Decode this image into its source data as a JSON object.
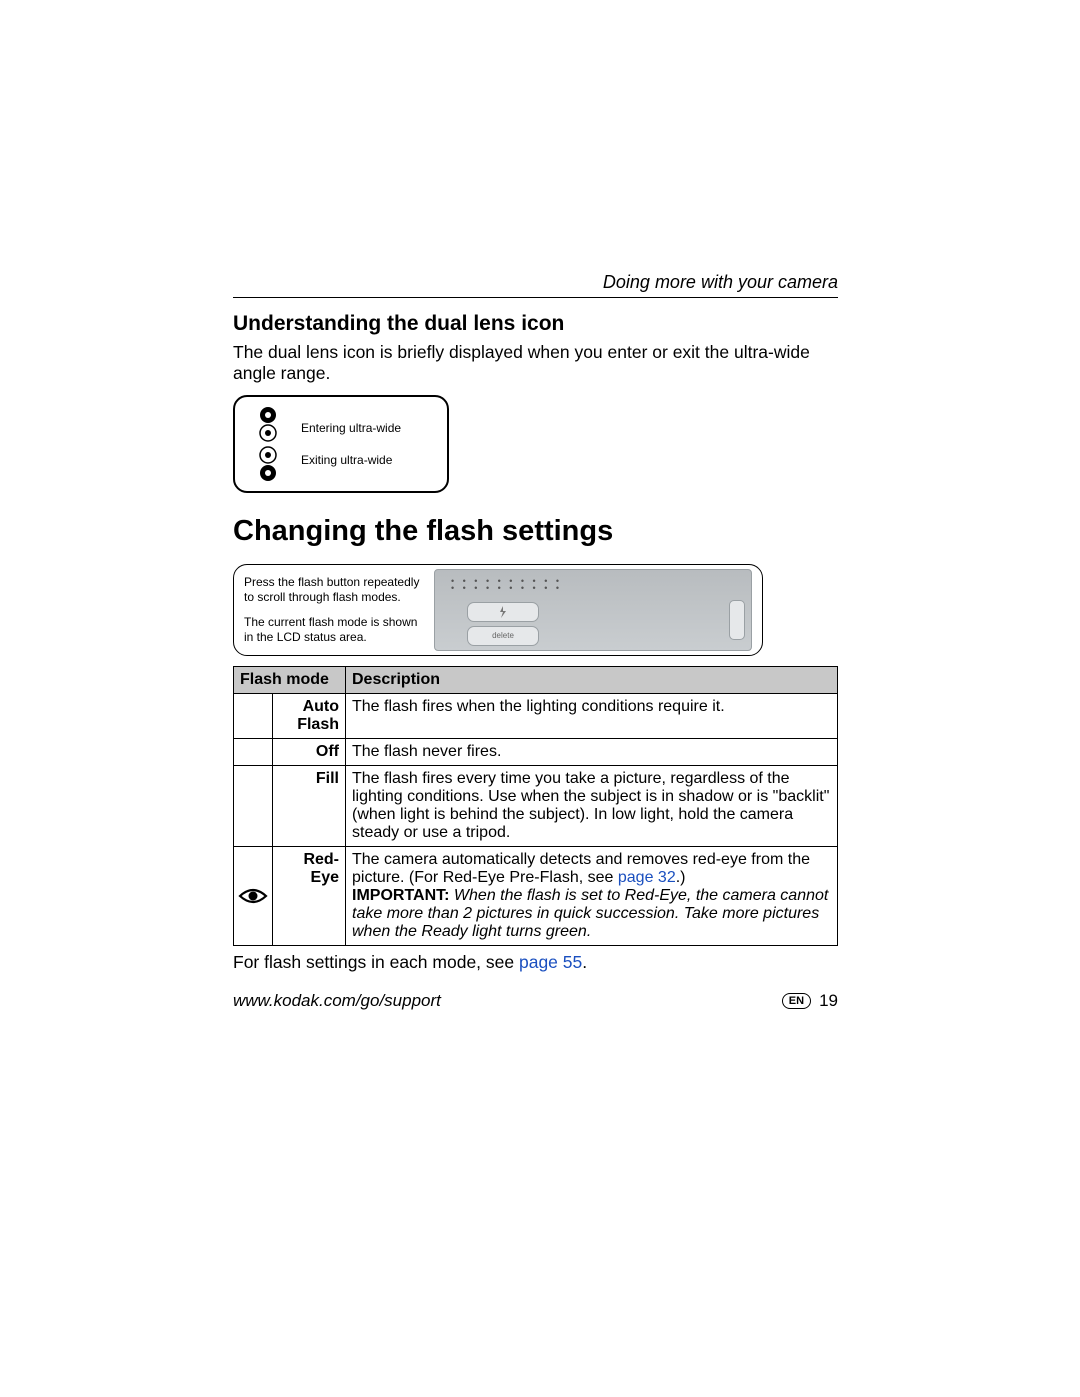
{
  "chapter": "Doing more with your camera",
  "section1": {
    "heading": "Understanding the dual lens icon",
    "body": "The dual lens icon is briefly displayed when you enter or exit the ultra-wide angle range.",
    "label_enter": "Entering ultra-wide",
    "label_exit": "Exiting ultra-wide"
  },
  "section2": {
    "heading": "Changing the flash settings",
    "callout_line1": "Press the flash button repeatedly to scroll through flash modes.",
    "callout_line2": "The current flash mode is shown in the LCD status area.",
    "camera_btn2_label": "delete"
  },
  "table": {
    "col1": "Flash mode",
    "col2": "Description",
    "rows": [
      {
        "mode": "Auto Flash",
        "desc": "The flash fires when the lighting conditions require it."
      },
      {
        "mode": "Off",
        "desc": "The flash never fires."
      },
      {
        "mode": "Fill",
        "desc": "The flash fires every time you take a picture, regardless of the lighting conditions. Use when the subject is in shadow or is \"backlit\" (when light is behind the subject). In low light, hold the camera steady or use a tripod."
      },
      {
        "mode": "Red-Eye",
        "desc_pre": "The camera automatically detects and removes red-eye from the picture. (For Red-Eye Pre-Flash, see ",
        "desc_link": "page 32",
        "desc_post": ".)",
        "important_label": "IMPORTANT:",
        "important_text": "When the flash is set to Red-Eye, the camera cannot take more than 2 pictures in quick succession. Take more pictures when the Ready light turns green."
      }
    ]
  },
  "after_table_pre": "For flash settings in each mode, see ",
  "after_table_link": "page 55",
  "after_table_post": ".",
  "footer": {
    "url": "www.kodak.com/go/support",
    "lang": "EN",
    "page": "19"
  }
}
